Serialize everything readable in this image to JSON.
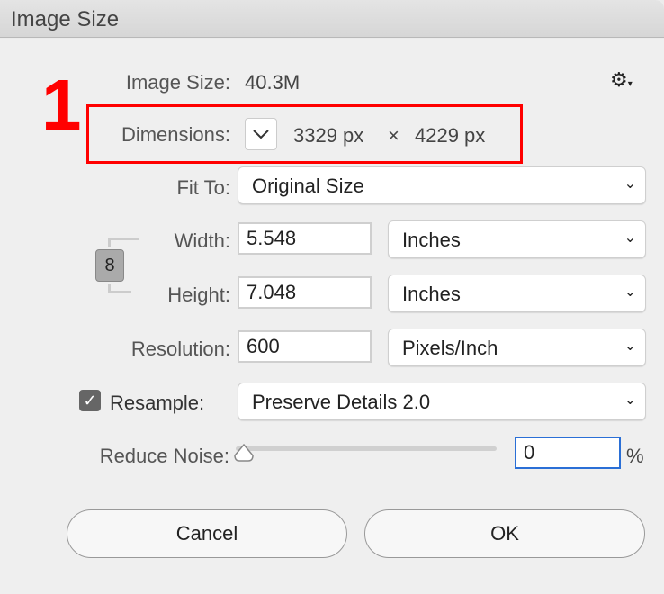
{
  "window": {
    "title": "Image Size"
  },
  "annotation": {
    "step_number": "1",
    "highlight_color": "#ff0000"
  },
  "info": {
    "image_size_label": "Image Size:",
    "image_size_value": "40.3M",
    "dimensions_label": "Dimensions:",
    "width_px": "3329 px",
    "times": "×",
    "height_px": "4229 px"
  },
  "fit_to": {
    "label": "Fit To:",
    "value": "Original Size"
  },
  "width": {
    "label": "Width:",
    "value": "5.548",
    "unit": "Inches"
  },
  "height": {
    "label": "Height:",
    "value": "7.048",
    "unit": "Inches"
  },
  "resolution": {
    "label": "Resolution:",
    "value": "600",
    "unit": "Pixels/Inch"
  },
  "resample": {
    "label": "Resample:",
    "checked": true,
    "value": "Preserve Details 2.0"
  },
  "reduce_noise": {
    "label": "Reduce Noise:",
    "value": "0",
    "unit": "%",
    "slider_fraction": 0
  },
  "buttons": {
    "cancel": "Cancel",
    "ok": "OK"
  }
}
